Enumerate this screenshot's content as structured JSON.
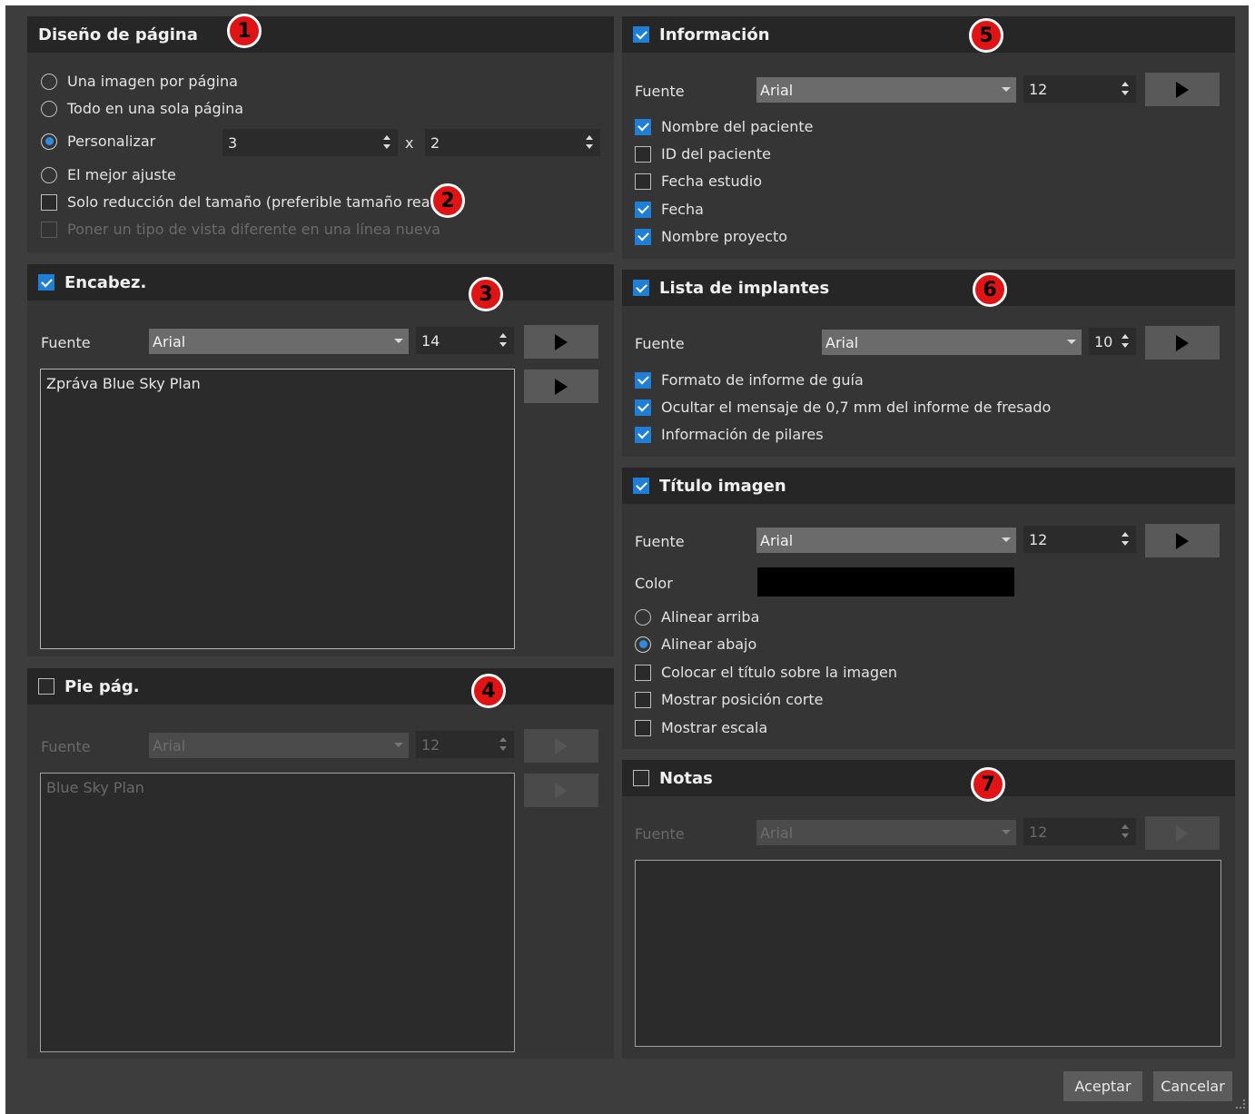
{
  "page_layout": {
    "title": "Diseño de página",
    "options": [
      {
        "label": "Una imagen por página",
        "selected": false
      },
      {
        "label": "Todo en una sola página",
        "selected": false
      },
      {
        "label": "Personalizar",
        "selected": true
      },
      {
        "label": "El mejor ajuste",
        "selected": false
      }
    ],
    "custom_cols": "3",
    "times": "x",
    "custom_rows": "2",
    "shrink_only": {
      "label": "Solo reducción del tamaño (preferible tamaño real)",
      "checked": false
    },
    "new_line": {
      "label": "Poner un tipo de vista diferente en una línea nueva",
      "checked": false,
      "disabled": true
    }
  },
  "header": {
    "title": "Encabez.",
    "enabled": true,
    "font_label": "Fuente",
    "font": "Arial",
    "size": "14",
    "text": "Zpráva Blue Sky Plan"
  },
  "footer": {
    "title": "Pie pág.",
    "enabled": false,
    "font_label": "Fuente",
    "font": "Arial",
    "size": "12",
    "text": "Blue Sky Plan"
  },
  "information": {
    "title": "Información",
    "enabled": true,
    "font_label": "Fuente",
    "font": "Arial",
    "size": "12",
    "items": [
      {
        "label": "Nombre del paciente",
        "checked": true
      },
      {
        "label": "ID del paciente",
        "checked": false
      },
      {
        "label": "Fecha estudio",
        "checked": false
      },
      {
        "label": "Fecha",
        "checked": true
      },
      {
        "label": "Nombre proyecto",
        "checked": true
      }
    ]
  },
  "implants": {
    "title": "Lista de implantes",
    "enabled": true,
    "font_label": "Fuente",
    "font": "Arial",
    "size": "10",
    "items": [
      {
        "label": "Formato de informe de guía",
        "checked": true
      },
      {
        "label": "Ocultar el mensaje de 0,7 mm del informe de fresado",
        "checked": true
      },
      {
        "label": "Información de pilares",
        "checked": true
      }
    ]
  },
  "image_title": {
    "title": "Título imagen",
    "enabled": true,
    "font_label": "Fuente",
    "font": "Arial",
    "size": "12",
    "color_label": "Color",
    "color": "#000000",
    "align_options": [
      {
        "label": "Alinear arriba",
        "selected": false
      },
      {
        "label": "Alinear abajo",
        "selected": true
      }
    ],
    "items": [
      {
        "label": "Colocar el título sobre la imagen",
        "checked": false
      },
      {
        "label": "Mostrar posición corte",
        "checked": false
      },
      {
        "label": "Mostrar escala",
        "checked": false
      }
    ]
  },
  "notes": {
    "title": "Notas",
    "enabled": false,
    "font_label": "Fuente",
    "font": "Arial",
    "size": "12",
    "text": ""
  },
  "badges": [
    "1",
    "2",
    "3",
    "4",
    "5",
    "6",
    "7"
  ],
  "buttons": {
    "ok": "Aceptar",
    "cancel": "Cancelar"
  },
  "icons": {
    "play": "play-icon",
    "spin": "spin-arrows-icon",
    "dropdown": "chevron-down-icon"
  },
  "colors": {
    "accent": "#1f7fd6",
    "badge": "#e01414",
    "panel_header": "#262626"
  }
}
